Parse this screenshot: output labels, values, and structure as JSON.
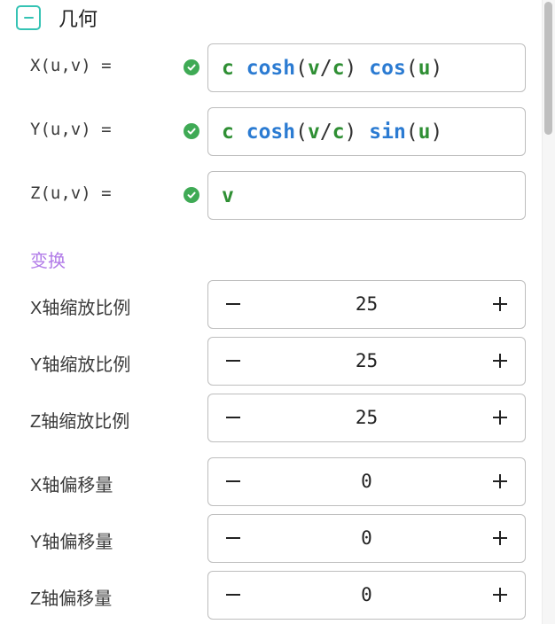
{
  "section": {
    "title": "几何",
    "collapse_icon": "minus-icon"
  },
  "formulas": [
    {
      "label": "X(u,v) =",
      "status": "valid",
      "tokens": [
        {
          "text": "c",
          "kind": "var"
        },
        {
          "text": " ",
          "kind": "op"
        },
        {
          "text": "cosh",
          "kind": "fn"
        },
        {
          "text": "(",
          "kind": "op"
        },
        {
          "text": "v",
          "kind": "var"
        },
        {
          "text": "/",
          "kind": "op"
        },
        {
          "text": "c",
          "kind": "var"
        },
        {
          "text": ") ",
          "kind": "op"
        },
        {
          "text": "cos",
          "kind": "fn"
        },
        {
          "text": "(",
          "kind": "op"
        },
        {
          "text": "u",
          "kind": "var"
        },
        {
          "text": ")",
          "kind": "op"
        }
      ]
    },
    {
      "label": "Y(u,v) =",
      "status": "valid",
      "tokens": [
        {
          "text": "c",
          "kind": "var"
        },
        {
          "text": " ",
          "kind": "op"
        },
        {
          "text": "cosh",
          "kind": "fn"
        },
        {
          "text": "(",
          "kind": "op"
        },
        {
          "text": "v",
          "kind": "var"
        },
        {
          "text": "/",
          "kind": "op"
        },
        {
          "text": "c",
          "kind": "var"
        },
        {
          "text": ") ",
          "kind": "op"
        },
        {
          "text": "sin",
          "kind": "fn"
        },
        {
          "text": "(",
          "kind": "op"
        },
        {
          "text": "u",
          "kind": "var"
        },
        {
          "text": ")",
          "kind": "op"
        }
      ]
    },
    {
      "label": "Z(u,v) =",
      "status": "valid",
      "tokens": [
        {
          "text": "v",
          "kind": "var"
        }
      ]
    }
  ],
  "transform": {
    "title": "变换",
    "fields": [
      {
        "label": "X轴缩放比例",
        "value": "25"
      },
      {
        "label": "Y轴缩放比例",
        "value": "25"
      },
      {
        "label": "Z轴缩放比例",
        "value": "25"
      },
      {
        "label": "X轴偏移量",
        "value": "0"
      },
      {
        "label": "Y轴偏移量",
        "value": "0"
      },
      {
        "label": "Z轴偏移量",
        "value": "0"
      }
    ]
  },
  "colors": {
    "accent_teal": "#35c3b4",
    "valid_green": "#3faa55",
    "variable_green": "#2f8f34",
    "function_blue": "#2b7bd2",
    "subsection_purple": "#b17be8"
  },
  "icons": {
    "valid": "check-circle-icon",
    "decrement": "minus-icon",
    "increment": "plus-icon"
  }
}
